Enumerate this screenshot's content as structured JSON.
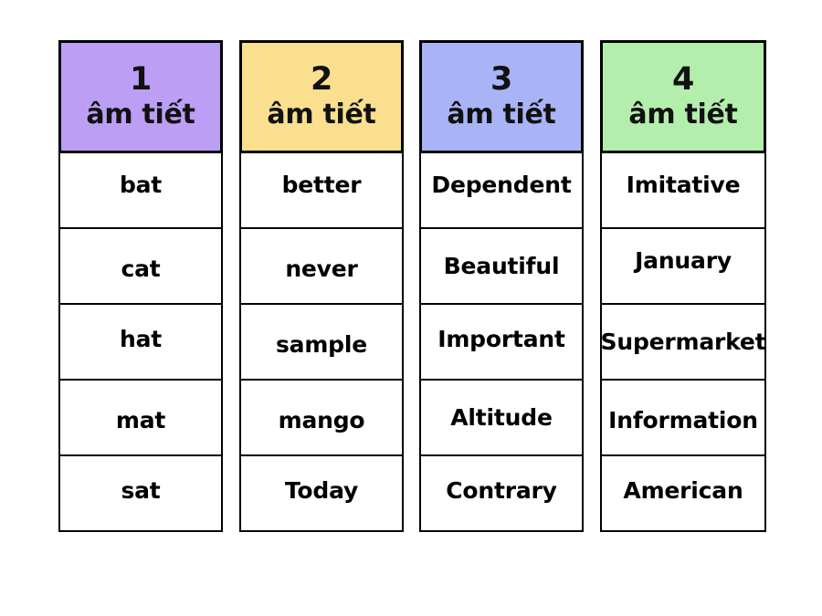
{
  "board": {
    "background": "#ffffff",
    "border_color": "#000000"
  },
  "columns": [
    {
      "number": "1",
      "label": "âm tiết",
      "header_color": "#bc9ef5",
      "words": [
        "bat",
        "cat",
        "hat",
        "mat",
        "sat"
      ]
    },
    {
      "number": "2",
      "label": "âm tiết",
      "header_color": "#fadf8e",
      "words": [
        "better",
        "never",
        "sample",
        "mango",
        "Today"
      ]
    },
    {
      "number": "3",
      "label": "âm tiết",
      "header_color": "#a8b4f5",
      "words": [
        "Dependent",
        "Beautiful",
        "Important",
        "Altitude",
        "Contrary"
      ]
    },
    {
      "number": "4",
      "label": "âm tiết",
      "header_color": "#b4eead",
      "words": [
        "Imitative",
        "January",
        "Supermarket",
        "Information",
        "American"
      ]
    }
  ]
}
